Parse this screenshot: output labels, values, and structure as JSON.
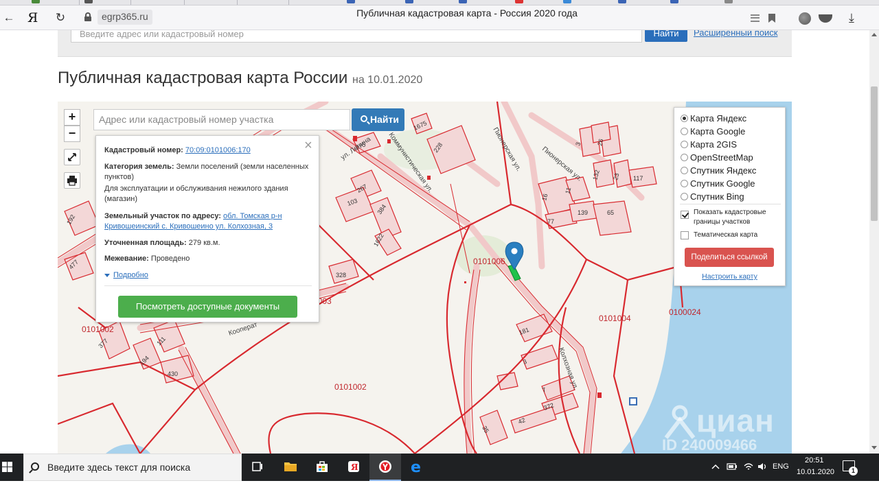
{
  "browser": {
    "brand_glyph": "Я",
    "domain": "egrp365.ru",
    "tab_title": "Публичная кадастровая карта - Россия 2020 года"
  },
  "site": {
    "search_placeholder": "Введите адрес или кадастровый номер",
    "search_button": "Найти",
    "advanced_search": "Расширенный поиск"
  },
  "heading": {
    "title": "Публичная кадастровая карта России",
    "date": "на 10.01.2020"
  },
  "map": {
    "zoom_in": "+",
    "zoom_out": "−",
    "search_placeholder": "Адрес или кадастровый номер участка",
    "search_button": "Найти",
    "quarter_labels": [
      "0101006",
      "0101003",
      "0101004",
      "0100024",
      "0101002",
      "0101002"
    ],
    "parcel_numbers": [
      "1675",
      "228",
      "375",
      "267",
      "103",
      "384",
      "1622",
      "328",
      "192",
      "477",
      "377",
      "111",
      "194",
      "430",
      "3",
      "26",
      "132",
      "23",
      "16",
      "11",
      "77",
      "139",
      "65",
      "181",
      "3",
      "7",
      "372",
      "35",
      "42",
      "117"
    ],
    "street_labels": [
      "ул. Ленина",
      "Пионерская ул.",
      "Пионерская ул.",
      "Колхозная ул.",
      "Коммунистическая ул.",
      "Кооперат"
    ]
  },
  "popup": {
    "cadastral_label": "Кадастровый номер:",
    "cadastral_value": "70:09:0101006:170",
    "category_label": "Категория земель:",
    "category_value": "Земли поселений (земли населенных пунктов)",
    "usage": "Для эксплуатации и обслуживания нежилого здания (магазин)",
    "address_label": "Земельный участок по адресу:",
    "address_value": "обл. Томская р-н Кривошеинский с. Кривошеино ул. Колхозная, 3",
    "area_label": "Уточненная площадь:",
    "area_value": "279 кв.м.",
    "survey_label": "Межевание:",
    "survey_value": "Проведено",
    "details_link": "Подробно",
    "docs_button": "Посмотреть доступные документы"
  },
  "layers": {
    "options": [
      "Карта Яндекс",
      "Карта Google",
      "Карта 2GIS",
      "OpenStreetMap",
      "Спутник Яндекс",
      "Спутник Google",
      "Спутник Bing"
    ],
    "selected_index": 0,
    "show_boundaries": "Показать кадастровые границы участков",
    "show_boundaries_checked": true,
    "thematic": "Тематическая карта",
    "thematic_checked": false,
    "share_button": "Поделиться ссылкой",
    "configure_link": "Настроить карту"
  },
  "watermark": {
    "brand": "циан",
    "id": "ID 240009466"
  },
  "taskbar": {
    "search_placeholder": "Введите здесь текст для поиска",
    "lang": "ENG",
    "time": "20:51",
    "date": "10.01.2020",
    "notifications": "1"
  },
  "colors": {
    "boundary": "#d8292f",
    "parcel_fill": "#f3d7d7",
    "water": "#a8d2ec",
    "link": "#2a6ebb",
    "primary": "#337ab7",
    "success": "#4cae4c",
    "danger": "#d9534f"
  }
}
